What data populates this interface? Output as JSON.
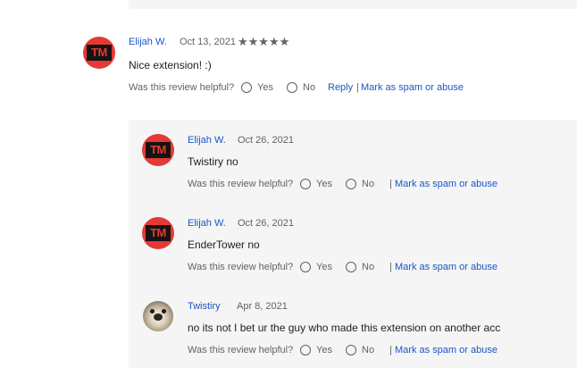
{
  "helpful_prompt": "Was this review helpful?",
  "yes_label": "Yes",
  "no_label": "No",
  "reply_label": "Reply",
  "separator": "|",
  "spam_label": "Mark as spam or abuse",
  "colors": {
    "link": "#1a56c9",
    "avatar_red": "#e53935",
    "panel_bg": "#f5f5f5"
  },
  "main_review": {
    "author": "Elijah W.",
    "date": "Oct 13, 2021",
    "stars": "★★★★★",
    "rating": 5,
    "avatar_text": "TM",
    "text": "Nice extension! :)"
  },
  "replies": [
    {
      "author": "Elijah W.",
      "date": "Oct 26, 2021",
      "avatar_text": "TM",
      "text": "Twistiry no"
    },
    {
      "author": "Elijah W.",
      "date": "Oct 26, 2021",
      "avatar_text": "TM",
      "text": "EnderTower no"
    },
    {
      "author": "Twistiry",
      "date": "Apr 8, 2021",
      "avatar_icon": "dog-avatar-icon",
      "text": "no its not I bet ur the guy who made this extension on another acc"
    }
  ]
}
